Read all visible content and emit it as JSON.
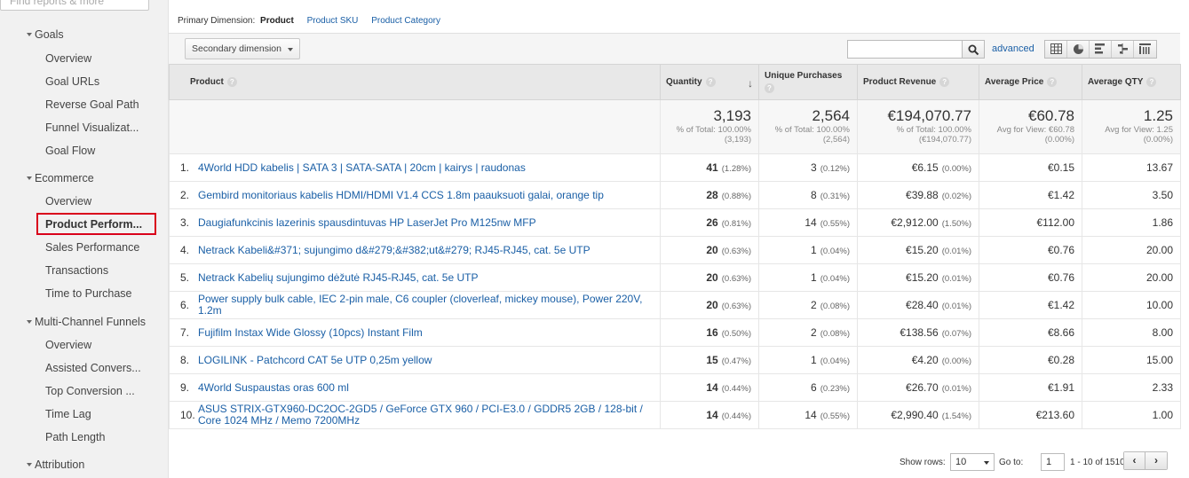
{
  "sidebar": {
    "search_placeholder": "Find reports & more",
    "groups": [
      {
        "label": "Goals"
      },
      {
        "label": "Ecommerce"
      },
      {
        "label": "Multi-Channel Funnels"
      },
      {
        "label": "Attribution"
      }
    ],
    "goals_items": [
      "Overview",
      "Goal URLs",
      "Reverse Goal Path",
      "Funnel Visualizat...",
      "Goal Flow"
    ],
    "ecommerce_items": [
      "Overview",
      "Product Perform...",
      "Sales Performance",
      "Transactions",
      "Time to Purchase"
    ],
    "mcf_items": [
      "Overview",
      "Assisted Convers...",
      "Top Conversion ...",
      "Time Lag",
      "Path Length"
    ]
  },
  "primary_dimension": {
    "label": "Primary Dimension:",
    "selected": "Product",
    "options": [
      "Product SKU",
      "Product Category"
    ]
  },
  "toolbar": {
    "secondary_dimension": "Secondary dimension",
    "advanced": "advanced"
  },
  "table": {
    "headers": {
      "product": "Product",
      "quantity": "Quantity",
      "unique_purchases": "Unique Purchases",
      "product_revenue": "Product Revenue",
      "average_price": "Average Price",
      "average_qty": "Average QTY"
    },
    "totals": {
      "quantity": {
        "value": "3,193",
        "sub1": "% of Total: 100.00%",
        "sub2": "(3,193)"
      },
      "unique_purchases": {
        "value": "2,564",
        "sub1": "% of Total: 100.00%",
        "sub2": "(2,564)"
      },
      "product_revenue": {
        "value": "€194,070.77",
        "sub1": "% of Total: 100.00%",
        "sub2": "(€194,070.77)"
      },
      "average_price": {
        "value": "€60.78",
        "sub1": "Avg for View: €60.78",
        "sub2": "(0.00%)"
      },
      "average_qty": {
        "value": "1.25",
        "sub1": "Avg for View: 1.25",
        "sub2": "(0.00%)"
      }
    },
    "rows": [
      {
        "idx": "1.",
        "product": "4World HDD kabelis | SATA 3 | SATA-SATA | 20cm | kairys | raudonas",
        "qty": "41",
        "qty_pct": "(1.28%)",
        "up": "3",
        "up_pct": "(0.12%)",
        "rev": "€6.15",
        "rev_pct": "(0.00%)",
        "price": "€0.15",
        "avgqty": "13.67"
      },
      {
        "idx": "2.",
        "product": "Gembird monitoriaus kabelis HDMI/HDMI V1.4 CCS 1.8m paauksuoti galai, orange tip",
        "qty": "28",
        "qty_pct": "(0.88%)",
        "up": "8",
        "up_pct": "(0.31%)",
        "rev": "€39.88",
        "rev_pct": "(0.02%)",
        "price": "€1.42",
        "avgqty": "3.50"
      },
      {
        "idx": "3.",
        "product": "Daugiafunkcinis lazerinis spausdintuvas HP LaserJet Pro M125nw MFP",
        "qty": "26",
        "qty_pct": "(0.81%)",
        "up": "14",
        "up_pct": "(0.55%)",
        "rev": "€2,912.00",
        "rev_pct": "(1.50%)",
        "price": "€112.00",
        "avgqty": "1.86"
      },
      {
        "idx": "4.",
        "product": "Netrack Kabeli&#371; sujungimo d&#279;&#382;ut&#279; RJ45-RJ45, cat. 5e UTP",
        "qty": "20",
        "qty_pct": "(0.63%)",
        "up": "1",
        "up_pct": "(0.04%)",
        "rev": "€15.20",
        "rev_pct": "(0.01%)",
        "price": "€0.76",
        "avgqty": "20.00"
      },
      {
        "idx": "5.",
        "product": "Netrack Kabelių sujungimo dėžutė RJ45-RJ45, cat. 5e UTP",
        "qty": "20",
        "qty_pct": "(0.63%)",
        "up": "1",
        "up_pct": "(0.04%)",
        "rev": "€15.20",
        "rev_pct": "(0.01%)",
        "price": "€0.76",
        "avgqty": "20.00"
      },
      {
        "idx": "6.",
        "product": "Power supply bulk cable, IEC 2-pin male, C6 coupler (cloverleaf, mickey mouse), Power 220V, 1.2m",
        "qty": "20",
        "qty_pct": "(0.63%)",
        "up": "2",
        "up_pct": "(0.08%)",
        "rev": "€28.40",
        "rev_pct": "(0.01%)",
        "price": "€1.42",
        "avgqty": "10.00",
        "two_line": true
      },
      {
        "idx": "7.",
        "product": "Fujifilm Instax Wide Glossy (10pcs) Instant Film",
        "qty": "16",
        "qty_pct": "(0.50%)",
        "up": "2",
        "up_pct": "(0.08%)",
        "rev": "€138.56",
        "rev_pct": "(0.07%)",
        "price": "€8.66",
        "avgqty": "8.00"
      },
      {
        "idx": "8.",
        "product": "LOGILINK - Patchcord CAT 5e UTP 0,25m yellow",
        "qty": "15",
        "qty_pct": "(0.47%)",
        "up": "1",
        "up_pct": "(0.04%)",
        "rev": "€4.20",
        "rev_pct": "(0.00%)",
        "price": "€0.28",
        "avgqty": "15.00"
      },
      {
        "idx": "9.",
        "product": "4World Suspaustas oras 600 ml",
        "qty": "14",
        "qty_pct": "(0.44%)",
        "up": "6",
        "up_pct": "(0.23%)",
        "rev": "€26.70",
        "rev_pct": "(0.01%)",
        "price": "€1.91",
        "avgqty": "2.33"
      },
      {
        "idx": "10.",
        "product": "ASUS STRIX-GTX960-DC2OC-2GD5 / GeForce GTX 960 / PCI-E3.0 / GDDR5 2GB / 128-bit / Core 1024 MHz / Memo 7200MHz",
        "qty": "14",
        "qty_pct": "(0.44%)",
        "up": "14",
        "up_pct": "(0.55%)",
        "rev": "€2,990.40",
        "rev_pct": "(1.54%)",
        "price": "€213.60",
        "avgqty": "1.00",
        "two_line": true
      }
    ]
  },
  "pager": {
    "show_rows_label": "Show rows:",
    "show_rows_value": "10",
    "goto_label": "Go to:",
    "goto_value": "1",
    "range": "1 - 10 of 1510",
    "prev": "‹",
    "next": "›"
  },
  "colors": {
    "link": "#1a5fa6",
    "active_outline": "#d9001b",
    "sidebar_bg": "#f1f1f1"
  }
}
